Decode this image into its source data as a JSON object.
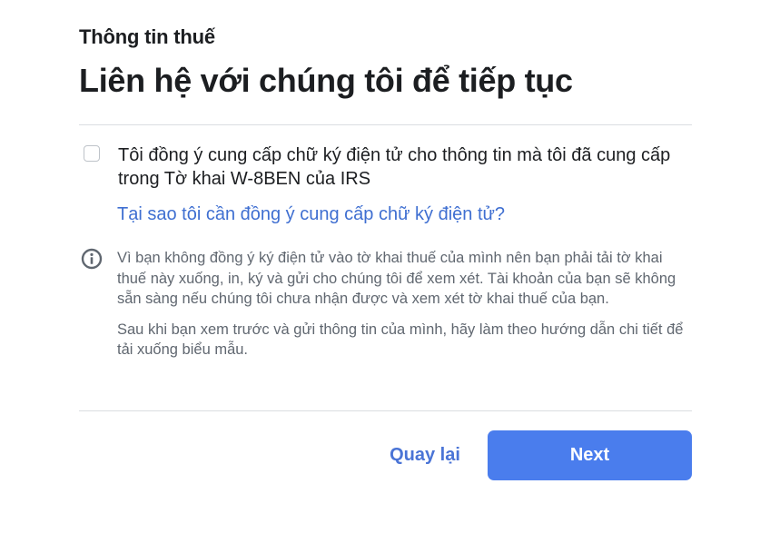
{
  "header": {
    "section_label": "Thông tin thuế",
    "title": "Liên hệ với chúng tôi để tiếp tục"
  },
  "consent": {
    "checked": false,
    "label": "Tôi đồng ý cung cấp chữ ký điện tử cho thông tin mà tôi đã cung cấp trong Tờ khai W-8BEN của IRS",
    "why_link": "Tại sao tôi cần đồng ý cung cấp chữ ký điện tử?"
  },
  "notice": {
    "icon": "info-icon",
    "paragraph_1": "Vì bạn không đồng ý ký điện tử vào tờ khai thuế của mình nên bạn phải tải tờ khai thuế này xuống, in, ký và gửi cho chúng tôi để xem xét. Tài khoản của bạn sẽ không sẵn sàng nếu chúng tôi chưa nhận được và xem xét tờ khai thuế của bạn.",
    "paragraph_2": "Sau khi bạn xem trước và gửi thông tin của mình, hãy làm theo hướng dẫn chi tiết để tải xuống biểu mẫu."
  },
  "footer": {
    "back_label": "Quay lại",
    "next_label": "Next"
  },
  "colors": {
    "primary_button": "#4a7ded",
    "link": "#3f6fd1",
    "muted_text": "#606770"
  }
}
